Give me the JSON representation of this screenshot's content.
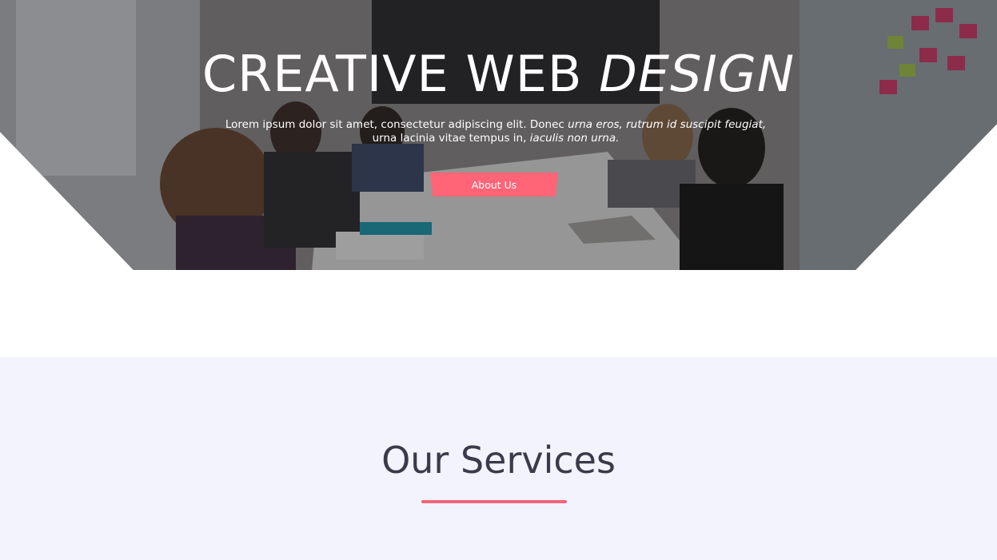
{
  "hero": {
    "title_part1": "CREATIVE WEB ",
    "title_part2": "DESIGN",
    "subtitle_part1": "Lorem ipsum dolor sit amet, consectetur adipiscing elit. Donec ",
    "subtitle_italic1": "urna eros, rutrum id suscipit feugiat,",
    "subtitle_part2": " urna lacinia vitae tempus in, ",
    "subtitle_italic2": "iaculis non urna.",
    "button_label": "About Us",
    "background_image": "team-meeting-photo"
  },
  "services": {
    "title": "Our Services"
  },
  "colors": {
    "accent": "#ff6577",
    "services_bg": "#f3f3fd",
    "title_text": "#3a3a4a"
  }
}
